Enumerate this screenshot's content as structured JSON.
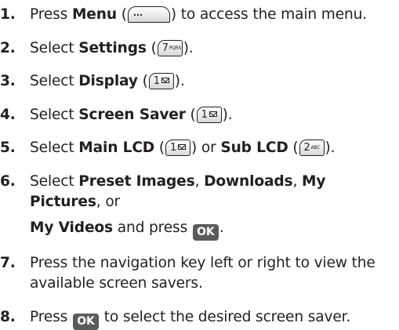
{
  "steps": [
    {
      "num": "1.",
      "parts": {
        "a": "Press ",
        "b": "Menu",
        "c": " (",
        "d": ") to access the main menu."
      },
      "key": "menu-key"
    },
    {
      "num": "2.",
      "parts": {
        "a": "Select ",
        "b": "Settings",
        "c": " (",
        "d": ")."
      },
      "key": {
        "digit": "7",
        "letters": "PQRS"
      }
    },
    {
      "num": "3.",
      "parts": {
        "a": "Select ",
        "b": "Display",
        "c": " (",
        "d": ")."
      },
      "key": {
        "digit": "1",
        "icon": "envelope-icon"
      }
    },
    {
      "num": "4.",
      "parts": {
        "a": "Select ",
        "b": "Screen Saver",
        "c": " (",
        "d": ")."
      },
      "key": {
        "digit": "1",
        "icon": "envelope-icon"
      }
    },
    {
      "num": "5.",
      "parts": {
        "a": "Select ",
        "b": "Main LCD",
        "c": " (",
        "d": ") or ",
        "e": "Sub LCD",
        "f": " (",
        "g": ")."
      },
      "key": {
        "digit": "1",
        "icon": "envelope-icon"
      },
      "key2": {
        "digit": "2",
        "letters": "ABC"
      }
    },
    {
      "num": "6.",
      "parts": {
        "a": "Select ",
        "b": "Preset Images",
        "c": ", ",
        "d": "Downloads",
        "e": ", ",
        "f": "My Pictures",
        "g": ", or",
        "h": "My Videos",
        "i": " and press ",
        "j": "."
      },
      "ok": "OK"
    },
    {
      "num": "7.",
      "line1": "Press the navigation key left or right to view the",
      "line2": "available screen savers."
    },
    {
      "num": "8.",
      "parts": {
        "a": "Press ",
        "b": " to select the desired screen saver."
      },
      "ok": "OK"
    }
  ],
  "colors": {
    "text": "#231f20",
    "ok_key": "#5b5b5b"
  }
}
